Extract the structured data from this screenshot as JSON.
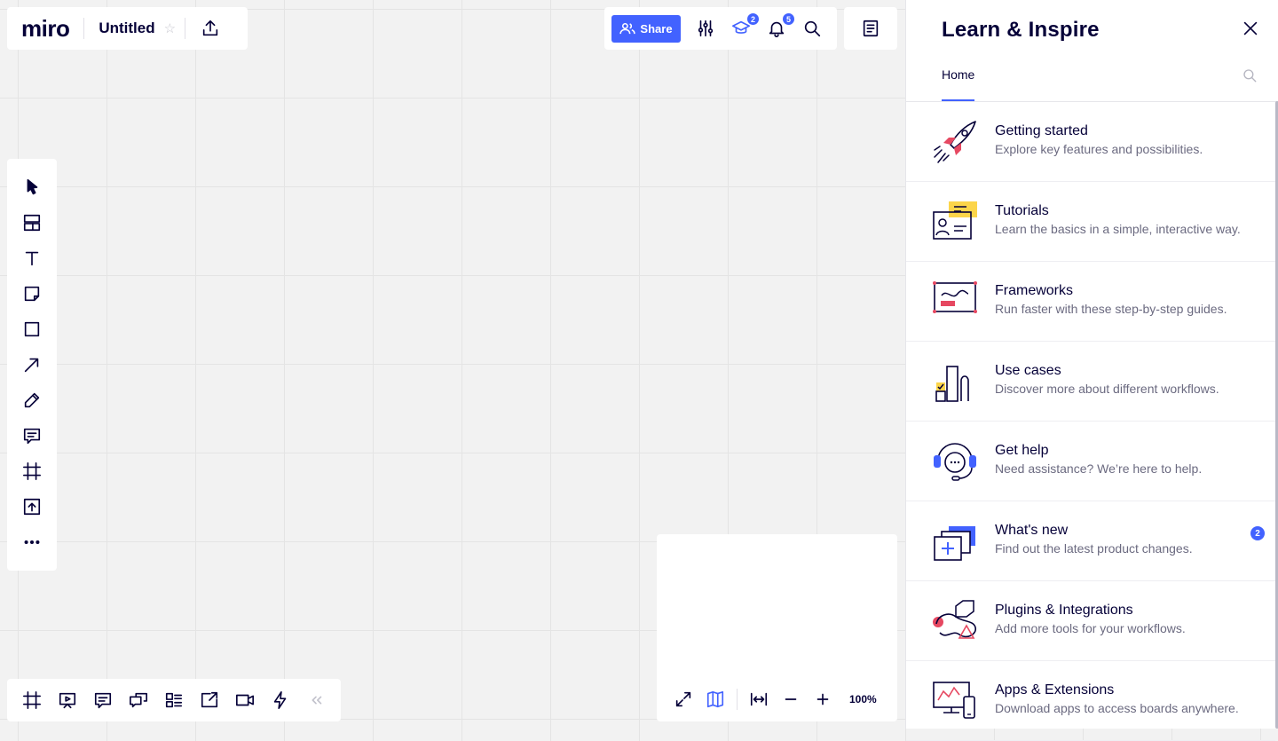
{
  "app": {
    "logo": "miro",
    "board_title": "Untitled"
  },
  "topbar": {
    "share_label": "Share",
    "learn_badge": "2",
    "notifications_badge": "5"
  },
  "minimap": {
    "zoom": "100%"
  },
  "learn_panel": {
    "title": "Learn & Inspire",
    "tabs": [
      {
        "label": "Home"
      }
    ],
    "items": [
      {
        "title": "Getting started",
        "desc": "Explore key features and possibilities.",
        "icon": "rocket-icon"
      },
      {
        "title": "Tutorials",
        "desc": "Learn the basics in a simple, interactive way.",
        "icon": "tutorials-icon"
      },
      {
        "title": "Frameworks",
        "desc": "Run faster with these step-by-step guides.",
        "icon": "frameworks-icon"
      },
      {
        "title": "Use cases",
        "desc": "Discover more about different workflows.",
        "icon": "use-cases-icon"
      },
      {
        "title": "Get help",
        "desc": "Need assistance? We’re here to help.",
        "icon": "headset-icon"
      },
      {
        "title": "What's new",
        "desc": "Find out the latest product changes.",
        "icon": "whats-new-icon",
        "badge": "2"
      },
      {
        "title": "Plugins & Integrations",
        "desc": "Add more tools for your workflows.",
        "icon": "plugins-icon"
      },
      {
        "title": "Apps & Extensions",
        "desc": "Download apps to access boards anywhere.",
        "icon": "devices-icon"
      }
    ]
  },
  "colors": {
    "accent": "#4262ff",
    "ink": "#050038",
    "red": "#e64861",
    "yellow": "#fcd54a",
    "canvas": "#f2f2f2"
  }
}
